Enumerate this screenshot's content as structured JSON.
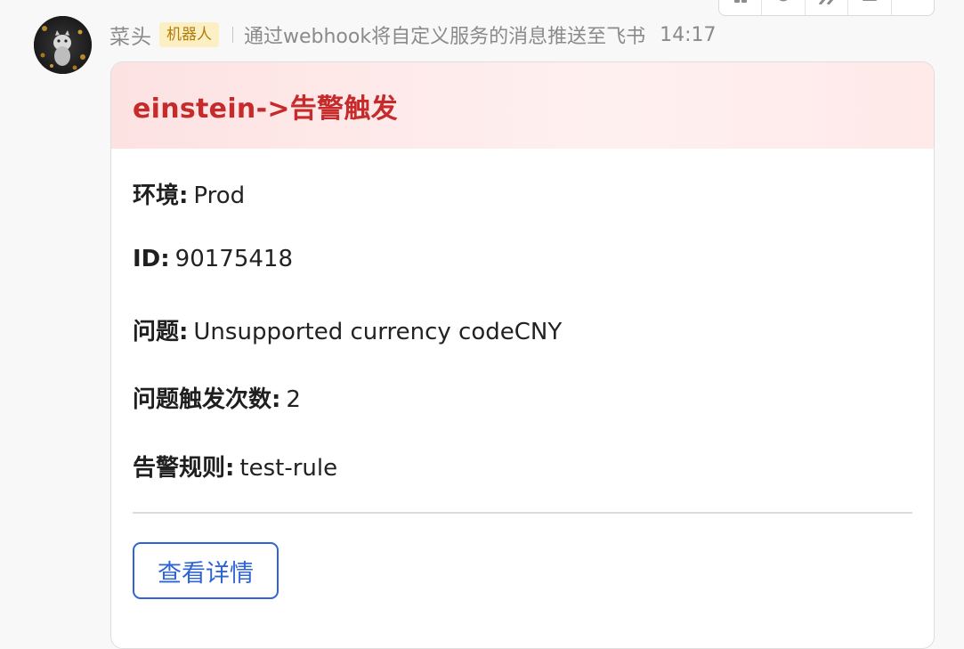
{
  "message": {
    "sender_name": "菜头",
    "bot_badge": "机器人",
    "bot_description": "通过webhook将自定义服务的消息推送至飞书",
    "time": "14:17"
  },
  "toolbar": {
    "icons": [
      "card-icon",
      "reaction-icon",
      "forward-icon",
      "more-icon",
      "blank"
    ]
  },
  "card": {
    "title": "einstein->告警触发",
    "header_color": "#fde2e2",
    "title_color": "#c62a2a",
    "fields": [
      {
        "label": "环境:",
        "value": "Prod"
      },
      {
        "label": "ID:",
        "value": "90175418"
      },
      {
        "label": "问题:",
        "value": "Unsupported currency codeCNY"
      },
      {
        "label": "问题触发次数:",
        "value": "2"
      },
      {
        "label": "告警规则:",
        "value": "test-rule"
      }
    ],
    "button_label": "查看详情",
    "button_color": "#2f64d8"
  }
}
